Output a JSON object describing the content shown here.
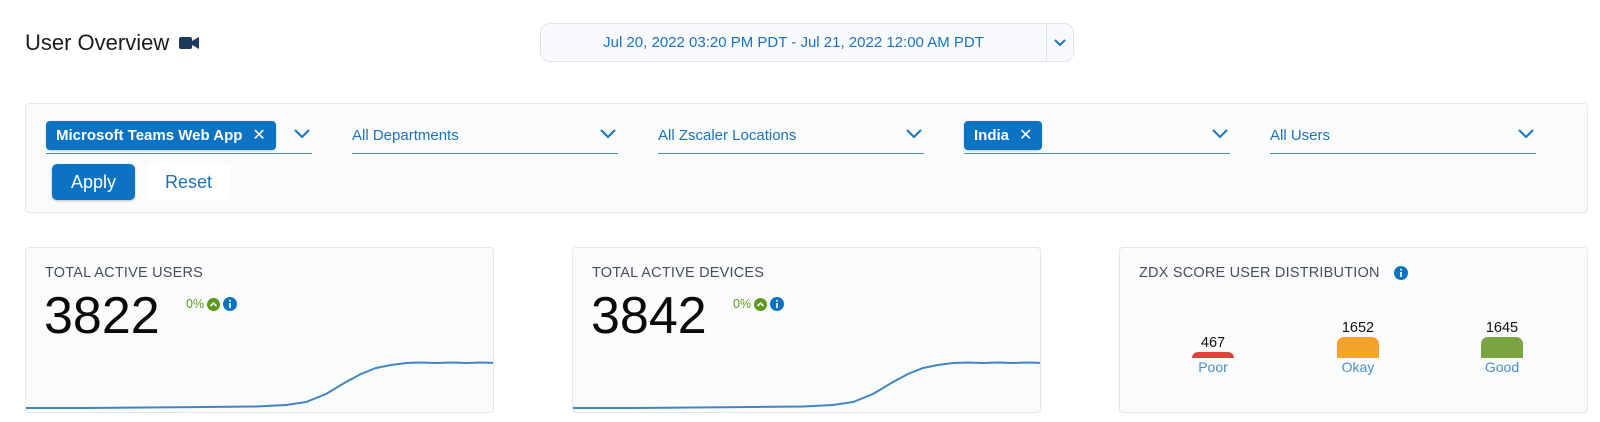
{
  "page": {
    "title": "User Overview",
    "title_icon": "video-camera-icon"
  },
  "date_range": {
    "value": "Jul 20, 2022 03:20 PM PDT - Jul 21, 2022 12:00 AM PDT",
    "toggle_icon": "chevron-down-icon"
  },
  "filters": {
    "application": {
      "chip": "Microsoft Teams Web App"
    },
    "departments": {
      "value": "All Departments"
    },
    "locations": {
      "value": "All Zscaler Locations"
    },
    "geolocation": {
      "chip": "India"
    },
    "users": {
      "value": "All Users"
    }
  },
  "actions": {
    "apply_label": "Apply",
    "reset_label": "Reset"
  },
  "cards": {
    "active_users": {
      "title": "TOTAL ACTIVE USERS",
      "value": "3822",
      "delta": "0%"
    },
    "active_devices": {
      "title": "TOTAL ACTIVE DEVICES",
      "value": "3842",
      "delta": "0%"
    },
    "score_distribution": {
      "title": "ZDX SCORE USER DISTRIBUTION",
      "buckets": [
        {
          "label": "Poor",
          "count": "467",
          "color": "#d9453b"
        },
        {
          "label": "Okay",
          "count": "1652",
          "color": "#f5a32b"
        },
        {
          "label": "Good",
          "count": "1645",
          "color": "#7ba543"
        }
      ]
    }
  },
  "colors": {
    "accent": "#0c73c2",
    "link": "#1a73bf",
    "positive": "#5d9a1c"
  }
}
